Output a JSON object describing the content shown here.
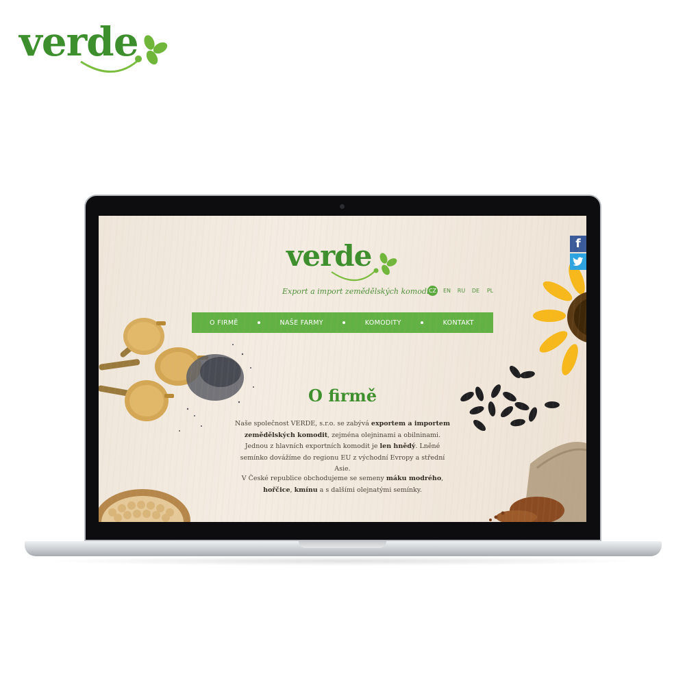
{
  "brand": {
    "logo_text": "verde",
    "color": "#3c8f2c"
  },
  "site": {
    "logo_text": "verde",
    "tagline": "Export a import zemědělských komodit",
    "languages": [
      {
        "code": "CZ",
        "active": true
      },
      {
        "code": "EN",
        "active": false
      },
      {
        "code": "RU",
        "active": false
      },
      {
        "code": "DE",
        "active": false
      },
      {
        "code": "PL",
        "active": false
      }
    ],
    "nav": [
      "O FIRMĚ",
      "NAŠE FARMY",
      "KOMODITY",
      "KONTAKT"
    ],
    "social": {
      "facebook": "f",
      "twitter": "twitter-bird-icon"
    },
    "section_title": "O firmě",
    "paragraph1": [
      {
        "text": "Naše společnost VERDE, s.r.o. se zabývá ",
        "bold": false
      },
      {
        "text": "exportem a importem zemědělských komodit",
        "bold": true
      },
      {
        "text": ", zejména olejninami a obilninami. Jednou z hlavních exportních komodit je ",
        "bold": false
      },
      {
        "text": "len hnědý",
        "bold": true
      },
      {
        "text": ". Lněné semínko dovážíme do regionu EU z východní Evropy a střední Asie.",
        "bold": false
      }
    ],
    "paragraph2": [
      {
        "text": "V České republice obchodujeme se semeny ",
        "bold": false
      },
      {
        "text": "máku modrého",
        "bold": true
      },
      {
        "text": ", ",
        "bold": false
      },
      {
        "text": "hořčice",
        "bold": true
      },
      {
        "text": ", ",
        "bold": false
      },
      {
        "text": "kmínu",
        "bold": true
      },
      {
        "text": " a s dalšími olejnatými semínky.",
        "bold": false
      }
    ],
    "colors": {
      "green": "#62b144",
      "text": "#4a4236",
      "background": "#f2e9de"
    }
  }
}
